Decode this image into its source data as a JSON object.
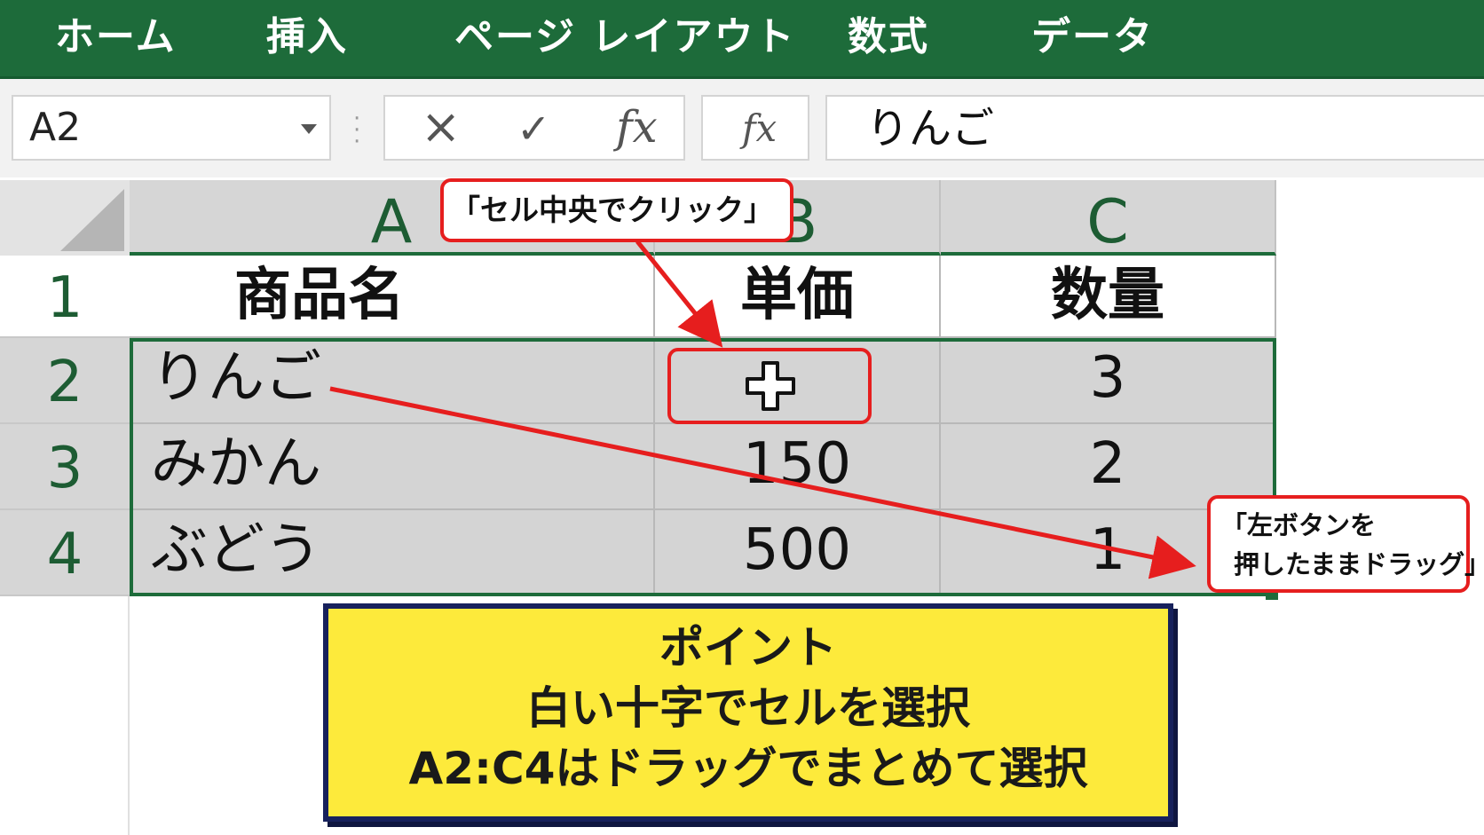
{
  "ribbon": {
    "tabs": [
      "ホーム",
      "挿入",
      "ページ レイアウト",
      "数式",
      "データ"
    ]
  },
  "formula_bar": {
    "name_box": "A2",
    "cancel_icon": "×",
    "enter_icon": "✓",
    "insert_function_label": "fx",
    "function_label": "fx",
    "formula_value": "りんご"
  },
  "sheet": {
    "columns": [
      "A",
      "B",
      "C"
    ],
    "rows": [
      "1",
      "2",
      "3",
      "4"
    ],
    "cells": [
      [
        "商品名",
        "単価",
        "数量"
      ],
      [
        "りんご",
        "",
        "3"
      ],
      [
        "みかん",
        "150",
        "2"
      ],
      [
        "ぶどう",
        "500",
        "1"
      ]
    ],
    "selected_range": "A2:C4",
    "active_cell": "A2"
  },
  "annotations": {
    "click_callout": "「セル中央でクリック」",
    "drag_callout_line1": "「左ボタンを",
    "drag_callout_line2": "押したままドラッグ」",
    "cursor_icon": "white-cross-cursor",
    "accent_color": "#e61e1e"
  },
  "point": {
    "title": "ポイント",
    "line1": "白い十字でセルを選択",
    "line2": "A2:C4はドラッグでまとめて選択"
  },
  "colors": {
    "ribbon": "#1d6b3a",
    "selection": "#1d6b3a",
    "point_background": "#fdea3b",
    "point_border": "#17215c"
  }
}
